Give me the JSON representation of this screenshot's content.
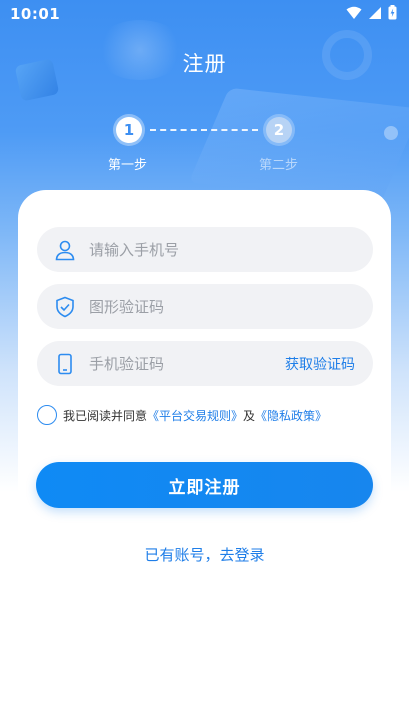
{
  "status_bar": {
    "time": "10:01",
    "icons": [
      "wifi-icon",
      "signal-icon",
      "battery-charging-icon"
    ]
  },
  "header": {
    "title": "注册"
  },
  "steps": [
    {
      "number": "1",
      "label": "第一步",
      "active": true
    },
    {
      "number": "2",
      "label": "第二步",
      "active": false
    }
  ],
  "form": {
    "phone": {
      "placeholder": "请输入手机号",
      "value": "",
      "icon": "user-icon"
    },
    "captcha": {
      "placeholder": "图形验证码",
      "value": "",
      "icon": "shield-check-icon"
    },
    "sms": {
      "placeholder": "手机验证码",
      "value": "",
      "icon": "phone-icon",
      "action": "获取验证码"
    }
  },
  "agreement": {
    "prefix": "我已阅读并同意",
    "link1": "《平台交易规则》",
    "conjunction": "及",
    "link2": "《隐私政策》",
    "checked": false
  },
  "register_button": "立即注册",
  "login_link": "已有账号，去登录",
  "colors": {
    "primary": "#1786ee",
    "link": "#1f7ee8",
    "hero_top": "#3d8ff2",
    "field_bg": "#f1f2f5"
  }
}
